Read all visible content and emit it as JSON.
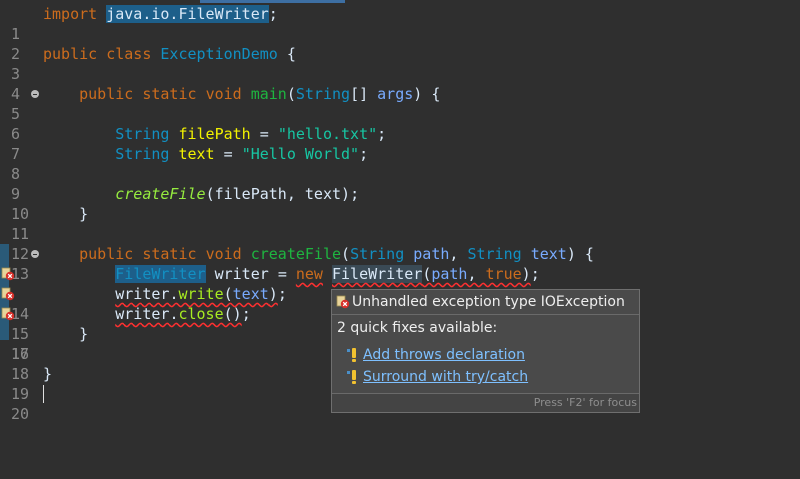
{
  "editor": {
    "lines": [
      {
        "n": "1"
      },
      {
        "n": "2"
      },
      {
        "n": "3"
      },
      {
        "n": "4"
      },
      {
        "n": "5"
      },
      {
        "n": "6"
      },
      {
        "n": "7"
      },
      {
        "n": "8"
      },
      {
        "n": "9"
      },
      {
        "n": "10"
      },
      {
        "n": "11"
      },
      {
        "n": "12"
      },
      {
        "n": "13"
      },
      {
        "n": "14"
      },
      {
        "n": "15"
      },
      {
        "n": "16"
      },
      {
        "n": "17"
      },
      {
        "n": "18"
      },
      {
        "n": "19"
      },
      {
        "n": "20"
      }
    ],
    "tokens": {
      "import": "import",
      "import_path": "java.io.FileWriter",
      "semi": ";",
      "public": "public",
      "class": "class",
      "class_name": "ExceptionDemo",
      "open_brace": "{",
      "close_brace": "}",
      "static": "static",
      "void": "void",
      "main": "main",
      "string_type": "String",
      "array_brackets": "[]",
      "args": "args",
      "paren_open": "(",
      "paren_close": ")",
      "filePath": "filePath",
      "text": "text",
      "equals": "=",
      "hello_txt": "\"hello.txt\"",
      "hello_world": "\"Hello World\"",
      "createFile": "createFile",
      "comma": ",",
      "path": "path",
      "filewriter": "FileWriter",
      "writer": "writer",
      "new": "new",
      "true": "true",
      "dot": ".",
      "write": "write",
      "close": "close",
      "empty_parens": "()"
    }
  },
  "popup": {
    "title": "Unhandled exception type IOException",
    "subtitle": "2 quick fixes available:",
    "fixes": [
      {
        "label": "Add throws declaration"
      },
      {
        "label": "Surround with try/catch"
      }
    ],
    "footer": "Press 'F2' for focus"
  },
  "colors": {
    "background": "#2f2f2f",
    "keyword": "#cc6c1d",
    "type": "#1290c3",
    "string": "#17c6a3",
    "error": "#ff3030",
    "link": "#7ec0ff"
  },
  "icons": {
    "error": "error-x-icon",
    "quickfix": "lightbulb-warning-icon",
    "fold": "fold-minus-icon"
  }
}
